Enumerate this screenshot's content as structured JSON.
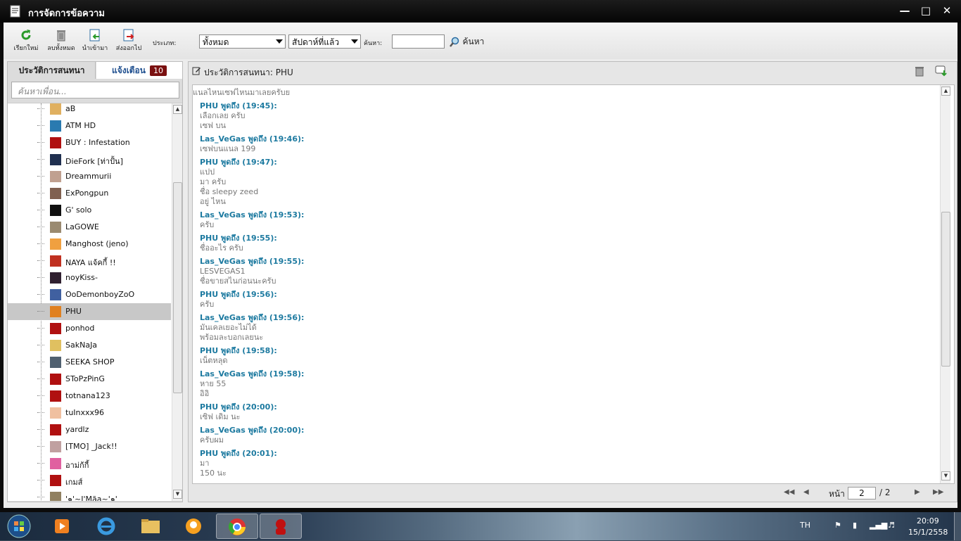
{
  "window": {
    "title": "การจัดการข้อความ"
  },
  "toolbar": {
    "refresh_label": "เรียกใหม่",
    "delete_all_label": "ลบทั้งหมด",
    "import_label": "นำเข้ามา",
    "export_label": "ส่งออกไป",
    "type_label": "ประเภท:",
    "type_value": "ทั้งหมด",
    "period_value": "สัปดาห์ที่แล้ว",
    "search_label": "ค้นหา:",
    "search_value": "",
    "search_button": "ค้นหา"
  },
  "left": {
    "tab_history": "ประวัติการสนทนา",
    "tab_notify": "แจ้งเตือน",
    "notify_count": "10",
    "search_placeholder": "ค้นหาเพื่อน...",
    "friends": [
      {
        "name": "aB",
        "color": "#e0b060"
      },
      {
        "name": "ATM HD",
        "color": "#2a7ab0"
      },
      {
        "name": "BUY : Infestation",
        "color": "#b01010"
      },
      {
        "name": "DieFork [ท่าปั้น]",
        "color": "#203050"
      },
      {
        "name": "Dreammurii",
        "color": "#c0a090"
      },
      {
        "name": "ExPongpun",
        "color": "#806050"
      },
      {
        "name": "G' solo",
        "color": "#101010"
      },
      {
        "name": "LaGOWE",
        "color": "#9a8a70"
      },
      {
        "name": "Manghost (jeno)",
        "color": "#f0a040"
      },
      {
        "name": "NAYA แจ้คกี้ !!",
        "color": "#c03020"
      },
      {
        "name": "noyKiss-",
        "color": "#302030"
      },
      {
        "name": "OoDemonboyZoO",
        "color": "#4060a0"
      },
      {
        "name": "PHU",
        "color": "#e08020"
      },
      {
        "name": "ponhod",
        "color": "#b01010"
      },
      {
        "name": "SakNaJa",
        "color": "#e0c060"
      },
      {
        "name": "SEEKA SHOP",
        "color": "#506070"
      },
      {
        "name": "SToPzPinG",
        "color": "#b01010"
      },
      {
        "name": "totnana123",
        "color": "#b01010"
      },
      {
        "name": "tuInxxx96",
        "color": "#f0c0a0"
      },
      {
        "name": "yardlz",
        "color": "#b01010"
      },
      {
        "name": "[TMO]  _Jack!!",
        "color": "#c0a0a0"
      },
      {
        "name": "อาม่ก้กี้",
        "color": "#e060a0"
      },
      {
        "name": "เกมส์",
        "color": "#b01010"
      },
      {
        "name": "'๑'~I'Mãa~'๑'",
        "color": "#908060"
      }
    ],
    "selected_index": 12
  },
  "right": {
    "title": "ประวัติการสนทนา: PHU",
    "messages": [
      {
        "speaker": "",
        "lines": [
          "แนลไหนเซฟไหนมาเลยครับย"
        ]
      },
      {
        "speaker": "PHU พูดถึง  (19:45):",
        "lines": [
          "เลือกเลย ครับ",
          "เซฟ บน"
        ]
      },
      {
        "speaker": "Las_VeGas พูดถึง  (19:46):",
        "lines": [
          "เซฟบนแนล 199"
        ]
      },
      {
        "speaker": "PHU พูดถึง  (19:47):",
        "lines": [
          "แปป",
          "มา ครับ",
          "ชื่อ sleepy zeed",
          "อยู่ ไหน"
        ]
      },
      {
        "speaker": "Las_VeGas พูดถึง  (19:53):",
        "lines": [
          "ครับ"
        ]
      },
      {
        "speaker": "PHU พูดถึง  (19:55):",
        "lines": [
          "ชื่ออะไร ครับ"
        ]
      },
      {
        "speaker": "Las_VeGas พูดถึง  (19:55):",
        "lines": [
          "LESVEGAS1",
          "ชื่อขายสไนก่อนนะครับ"
        ]
      },
      {
        "speaker": "PHU พูดถึง  (19:56):",
        "lines": [
          "ครับ"
        ]
      },
      {
        "speaker": "Las_VeGas พูดถึง  (19:56):",
        "lines": [
          "มันเคลเยอะไม่ได้",
          "พร้อมละบอกเลยนะ"
        ]
      },
      {
        "speaker": "PHU พูดถึง  (19:58):",
        "lines": [
          "เน็ตหลุด"
        ]
      },
      {
        "speaker": "Las_VeGas พูดถึง  (19:58):",
        "lines": [
          "หาย 55",
          "อิอิ"
        ]
      },
      {
        "speaker": "PHU พูดถึง  (20:00):",
        "lines": [
          "เซิฟ เดิม นะ"
        ]
      },
      {
        "speaker": "Las_VeGas พูดถึง  (20:00):",
        "lines": [
          "ครับผม"
        ]
      },
      {
        "speaker": "PHU พูดถึง  (20:01):",
        "lines": [
          "มา",
          "150 นะ"
        ]
      }
    ],
    "pager": {
      "page_label": "หน้า",
      "current": "2",
      "total": "/ 2"
    }
  },
  "taskbar": {
    "lang": "TH",
    "time": "20:09",
    "date": "15/1/2558"
  },
  "colors": {
    "speaker": "#1d7aa0",
    "badge": "#7a1010"
  }
}
